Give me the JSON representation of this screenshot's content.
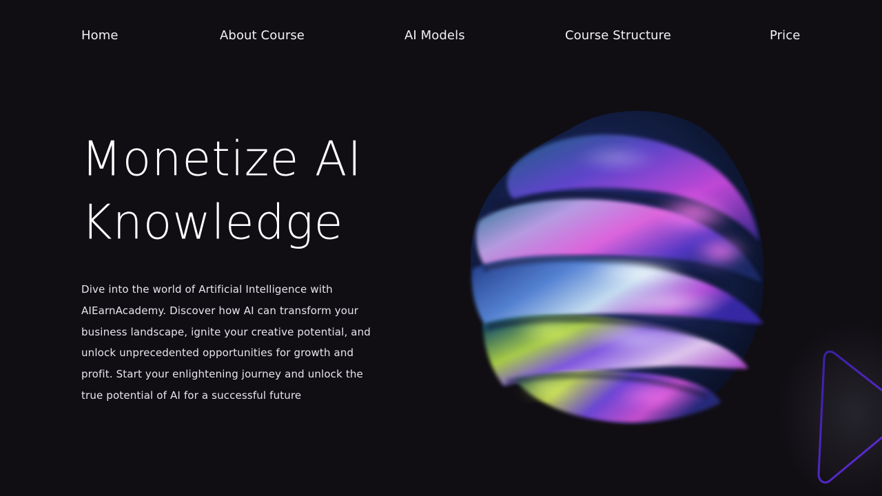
{
  "nav": {
    "items": [
      {
        "label": "Home"
      },
      {
        "label": "About Course"
      },
      {
        "label": "AI Models"
      },
      {
        "label": "Course Structure"
      },
      {
        "label": "Price"
      }
    ]
  },
  "hero": {
    "title_line1": "Monetize AI",
    "title_line2": "Knowledge",
    "description": "Dive into the world of Artificial Intelligence with AIEarnAcademy. Discover how AI can transform your business landscape, ignite your creative potential, and unlock unprecedented opportunities for growth and profit. Start your enlightening journey and unlock the true potential of AI for a successful future"
  },
  "icons": {
    "play": "play-icon",
    "hero_art": "iridescent-blob"
  },
  "colors": {
    "background": "#100e13",
    "text": "#ffffff",
    "accent": "#6a2ee0"
  }
}
